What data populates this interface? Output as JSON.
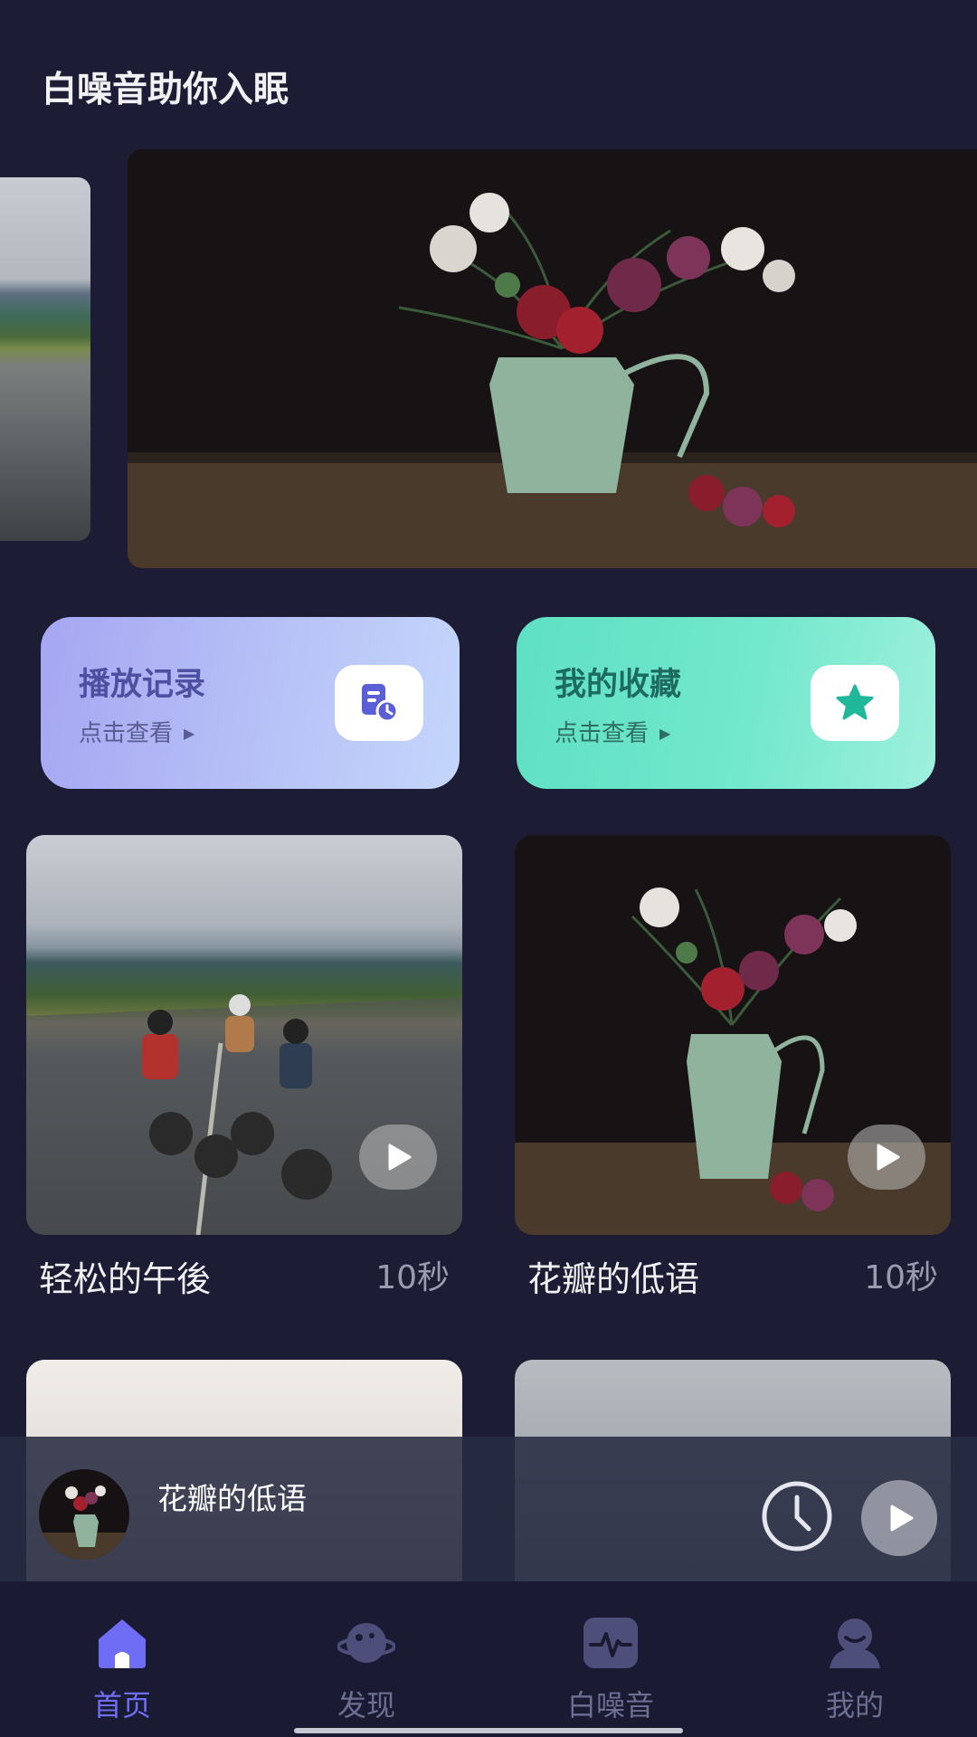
{
  "app": {
    "title": "白噪音助你入眠"
  },
  "quick_actions": [
    {
      "title": "播放记录",
      "subtitle": "点击查看",
      "icon": "history-doc-clock-icon",
      "color": "#4e4fa0"
    },
    {
      "title": "我的收藏",
      "subtitle": "点击查看",
      "icon": "star-icon",
      "color": "#1fb89a"
    }
  ],
  "media": [
    {
      "title": "轻松的午後",
      "duration": "10秒"
    },
    {
      "title": "花瓣的低语",
      "duration": "10秒"
    },
    {
      "title": "",
      "duration": ""
    },
    {
      "title": "",
      "duration": ""
    }
  ],
  "player": {
    "title": "花瓣的低语",
    "timer_icon": "clock-icon",
    "play_icon": "play-icon"
  },
  "nav": [
    {
      "label": "首页",
      "icon": "home-icon",
      "active": true
    },
    {
      "label": "发现",
      "icon": "planet-icon",
      "active": false
    },
    {
      "label": "白噪音",
      "icon": "waveform-icon",
      "active": false
    },
    {
      "label": "我的",
      "icon": "profile-icon",
      "active": false
    }
  ],
  "colors": {
    "background": "#1c1d35",
    "accent": "#6f6cf5",
    "nav_inactive": "#6c6e92"
  }
}
